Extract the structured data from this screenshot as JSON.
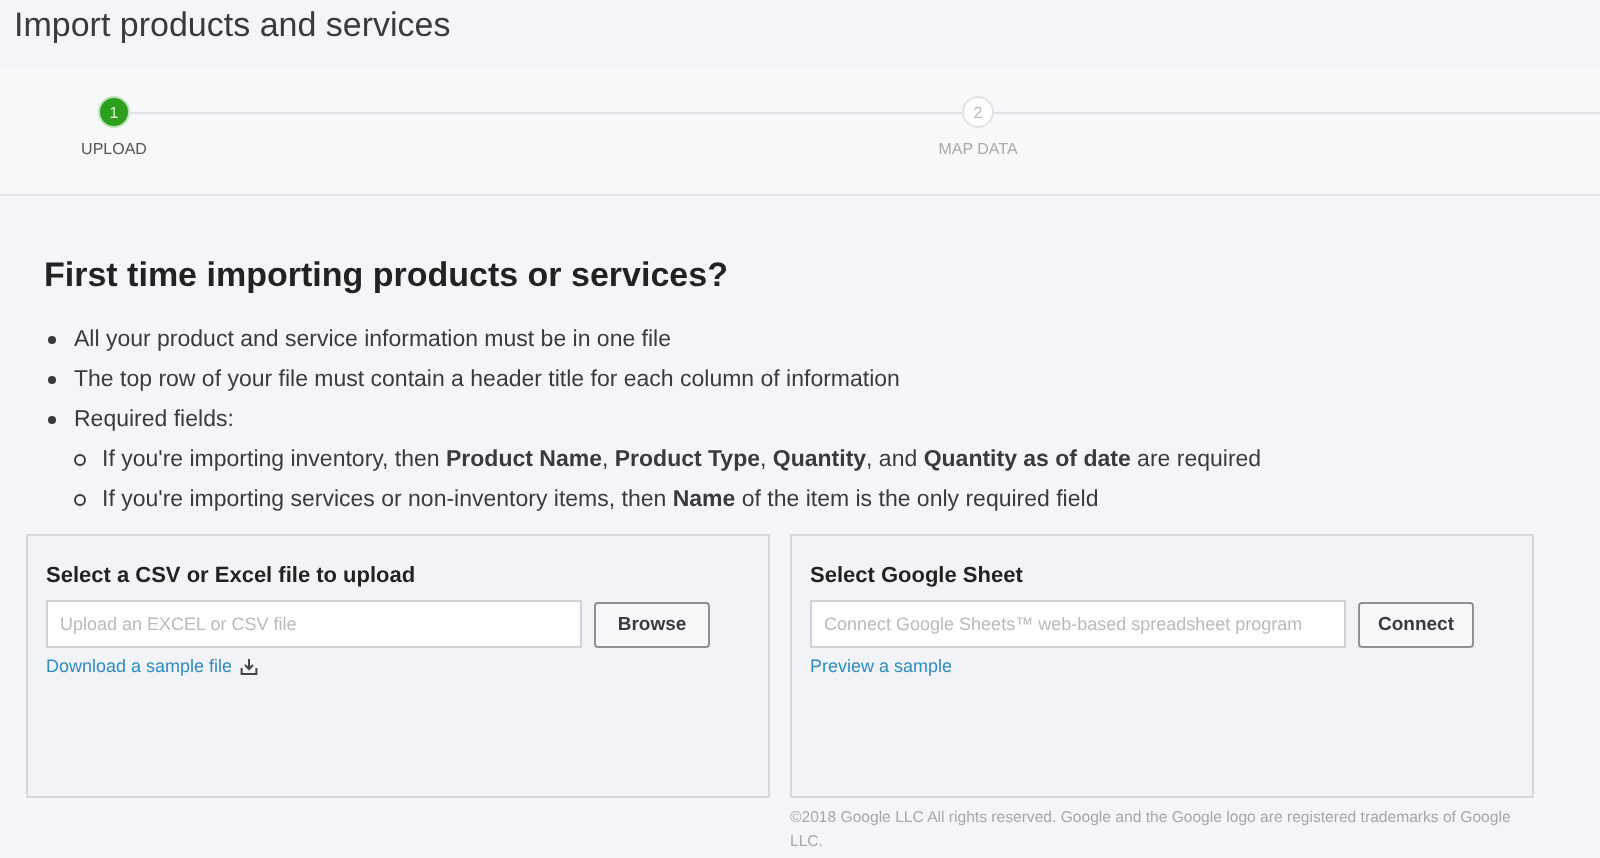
{
  "window": {
    "title": "Import products and services"
  },
  "steps": [
    {
      "number": "1",
      "label": "UPLOAD",
      "selected": true
    },
    {
      "number": "2",
      "label": "MAP DATA",
      "selected": false
    }
  ],
  "intro": {
    "heading": "First time importing products or services?",
    "bullets": [
      {
        "text": "All your product and service information must be in one file"
      },
      {
        "text": "The top row of your file must contain a header title for each column of information"
      },
      {
        "text": "Required fields:",
        "children": [
          {
            "text": "If you're importing inventory, then **Product Name**, **Product Type**, **Quantity**, and **Quantity as of date** are required"
          },
          {
            "text": "If you're importing services or non-inventory items, then **Name** of the item is the only required field"
          }
        ]
      }
    ]
  },
  "panels": [
    {
      "title": "Select a CSV or Excel file to upload",
      "placeholder": "Upload an EXCEL or CSV file",
      "button": "Browse",
      "link": "Download a sample file",
      "kind": "download"
    },
    {
      "title": "Select Google Sheet",
      "placeholder": "Connect Google Sheets™ web-based spreadsheet program",
      "button": "Connect",
      "link": "Preview a sample",
      "kind": "preview",
      "footnote": "©2018 Google LLC All rights reserved. Google and the Google logo are registered trademarks of Google LLC."
    }
  ]
}
